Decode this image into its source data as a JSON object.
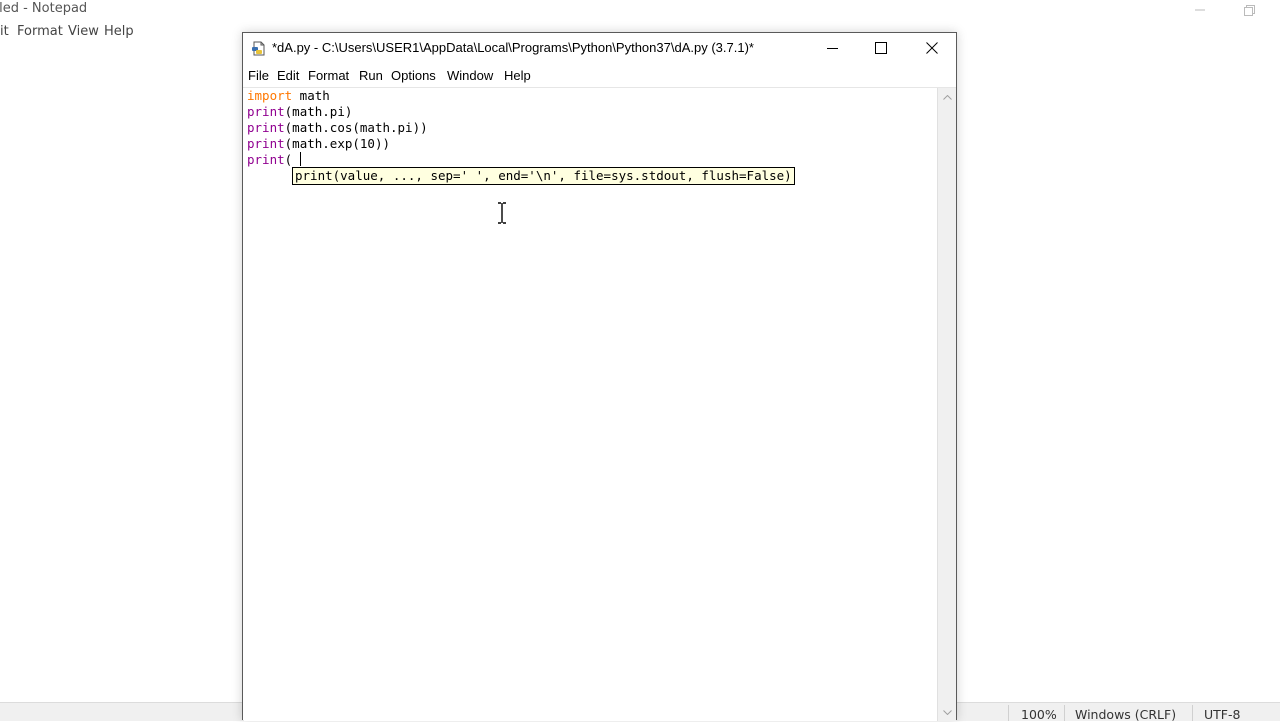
{
  "background_window": {
    "title": "tled - Notepad",
    "menu": [
      "it",
      "Format",
      "View",
      "Help"
    ],
    "status": {
      "zoom": "100%",
      "line_endings": "Windows (CRLF)",
      "encoding": "UTF-8"
    }
  },
  "idle_window": {
    "title": "*dA.py - C:\\Users\\USER1\\AppData\\Local\\Programs\\Python\\Python37\\dA.py (3.7.1)*",
    "menu": [
      "File",
      "Edit",
      "Format",
      "Run",
      "Options",
      "Window",
      "Help"
    ],
    "code": [
      {
        "kw": "import",
        "rest": " math"
      },
      {
        "bi": "print",
        "rest": "(math.pi)"
      },
      {
        "bi": "print",
        "rest": "(math.cos(math.pi))"
      },
      {
        "bi": "print",
        "rest": "(math.exp(10))"
      },
      {
        "bi": "print",
        "rest": "("
      }
    ],
    "calltip": "print(value, ..., sep=' ', end='\\n', file=sys.stdout, flush=False)"
  },
  "colors": {
    "keyword": "#ff7700",
    "builtin": "#900090",
    "calltip_bg": "#ffffe0"
  }
}
